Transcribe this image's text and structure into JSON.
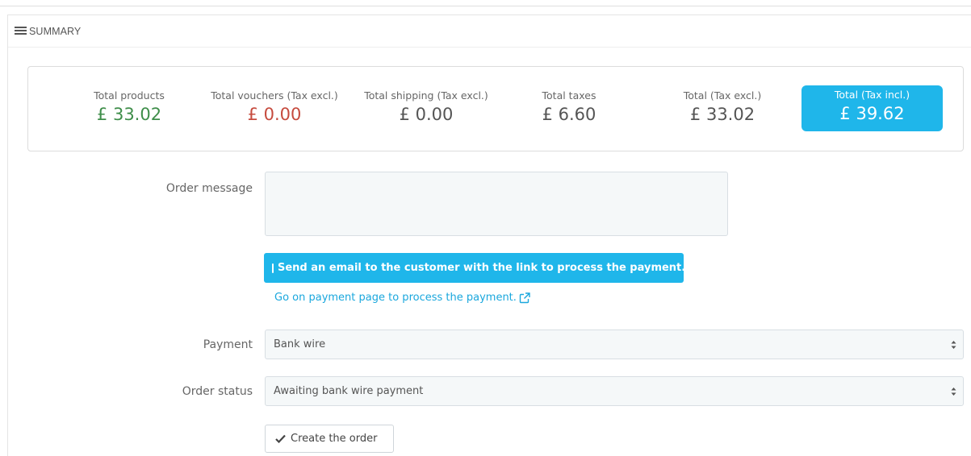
{
  "panel": {
    "title": "Summary",
    "icon": "list-icon"
  },
  "totals": {
    "products": {
      "label": "Total products",
      "value": "£ 33.02",
      "color": "#3f8e4a"
    },
    "vouchers": {
      "label": "Total vouchers (Tax excl.)",
      "value": "£ 0.00",
      "color": "#c64b3e"
    },
    "shipping": {
      "label": "Total shipping (Tax excl.)",
      "value": "£ 0.00"
    },
    "taxes": {
      "label": "Total taxes",
      "value": "£ 6.60"
    },
    "total_excl": {
      "label": "Total (Tax excl.)",
      "value": "£ 33.02"
    },
    "total_incl": {
      "label": "Total (Tax incl.)",
      "value": "£ 39.62",
      "color": "#1fb6ea"
    }
  },
  "form": {
    "order_message": {
      "label": "Order message",
      "value": ""
    },
    "email_button": {
      "label": "Send an email to the customer with the link to process the payment.",
      "icon": "credit-card-icon"
    },
    "payment_link": {
      "label": "Go on payment page to process the payment.",
      "icon": "external-link-icon"
    },
    "payment": {
      "label": "Payment",
      "selected": "Bank wire"
    },
    "order_status": {
      "label": "Order status",
      "selected": "Awaiting bank wire payment"
    },
    "create_button": {
      "label": "Create the order",
      "icon": "check-icon"
    }
  },
  "colors": {
    "accent": "#1fb6ea",
    "link": "#1aa7dd"
  }
}
